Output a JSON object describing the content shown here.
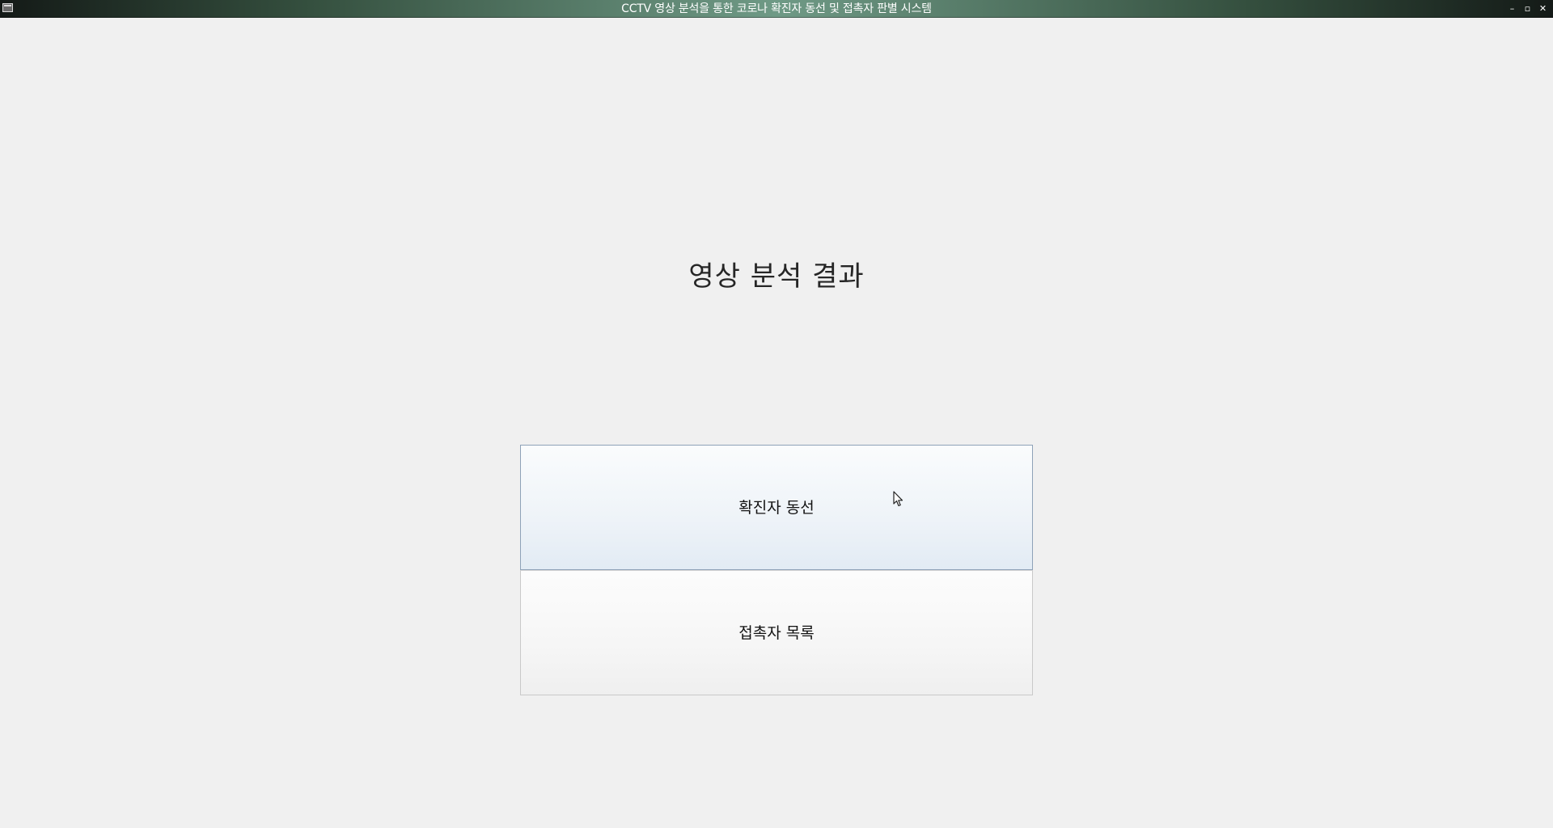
{
  "window": {
    "title": "CCTV 영상 분석을 통한 코로나 확진자 동선 및 접촉자 판별 시스템",
    "controls": {
      "minimize": "–",
      "maximize": "▫",
      "close": "✕"
    }
  },
  "main": {
    "heading": "영상 분석 결과",
    "buttons": {
      "patient_route": "확진자 동선",
      "contact_list": "접촉자 목록"
    }
  },
  "icons": {
    "app": "app-window-icon",
    "cursor": "mouse-pointer-icon"
  },
  "colors": {
    "titlebar_accent": "#6f9a86",
    "hover_button_border": "#8ea2b8",
    "background": "#f0f0f0"
  }
}
